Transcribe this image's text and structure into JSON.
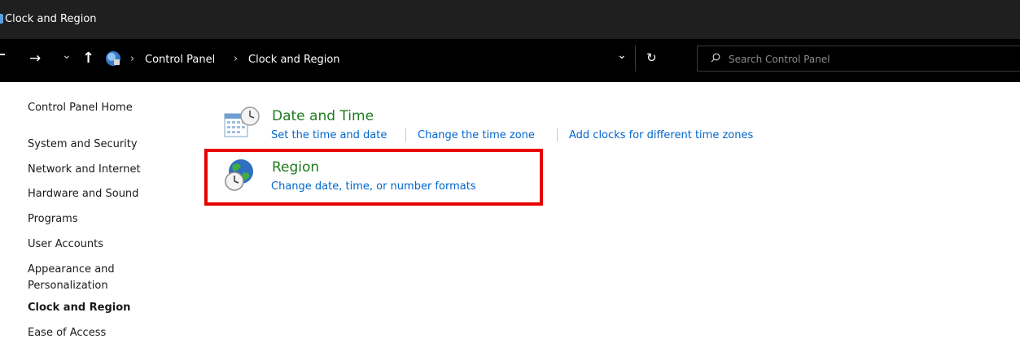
{
  "window": {
    "title": "Clock and Region"
  },
  "nav": {
    "forward_glyph": "→",
    "recent_glyph": "⌄",
    "up_glyph": "↑",
    "breadcrumb": [
      "Control Panel",
      "Clock and Region"
    ],
    "breadcrumb_sep": "›",
    "dropdown_glyph": "⌄",
    "refresh_glyph": "↻",
    "search_placeholder": "Search Control Panel"
  },
  "sidebar": {
    "home": "Control Panel Home",
    "items": [
      "System and Security",
      "Network and Internet",
      "Hardware and Sound",
      "Programs",
      "User Accounts",
      "Appearance and",
      "Personalization",
      "Clock and Region",
      "Ease of Access"
    ]
  },
  "sections": [
    {
      "title": "Date and Time",
      "icon": "calendar-clock-icon",
      "links": [
        "Set the time and date",
        "Change the time zone",
        "Add clocks for different time zones"
      ]
    },
    {
      "title": "Region",
      "icon": "globe-clock-icon",
      "links": [
        "Change date, time, or number formats"
      ]
    }
  ],
  "colors": {
    "title_bar": "#1f1f1f",
    "nav_bar": "#000000",
    "section_title": "#1e7b1e",
    "link": "#0066cc",
    "highlight": "#e60000"
  }
}
